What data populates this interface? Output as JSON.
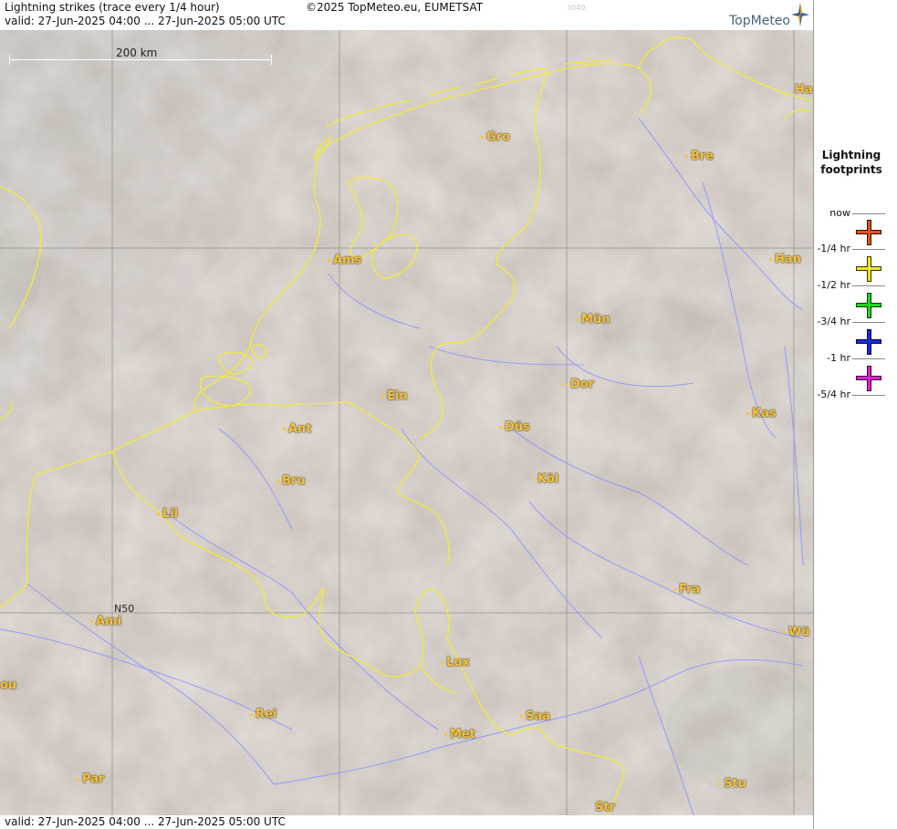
{
  "header": {
    "title": "Lightning strikes (trace every 1/4 hour)",
    "copyright": "©2025 TopMeteo.eu, EUMETSAT",
    "code": "3040",
    "valid": "valid:  27-Jun-2025 04:00 ... 27-Jun-2025 05:00 UTC",
    "brand": "TopMeteo"
  },
  "footer": {
    "valid": "valid:  27-Jun-2025 04:00 ... 27-Jun-2025 05:00 UTC"
  },
  "scale": {
    "label": "200 km"
  },
  "grid": {
    "lat_label": "N50"
  },
  "colors": {
    "border": "#f2ea3a",
    "rivers": "#8c96ff",
    "city": "#f5c542"
  },
  "cities": [
    "Ha",
    "Gro",
    "Bre",
    "Ams",
    "Han",
    "Mün",
    "Dor",
    "Ein",
    "Kas",
    "Ant",
    "Düs",
    "Bru",
    "Köl",
    "Lil",
    "Fra",
    "Ami",
    "Wü",
    "Lux",
    "ou",
    "Rei",
    "Saa",
    "Met",
    "Par",
    "Stu",
    "Str"
  ],
  "legend": {
    "title_line1": "Lightning",
    "title_line2": "footprints",
    "times": [
      "now",
      "-1/4 hr",
      "-1/2 hr",
      "-3/4 hr",
      "-1 hr",
      "-5/4 hr"
    ],
    "crosses": [
      {
        "name": "cross-now-quarter",
        "color": "#e8501a"
      },
      {
        "name": "cross-quarter-half",
        "color": "#f0e81a"
      },
      {
        "name": "cross-half-threequarter",
        "color": "#20d820"
      },
      {
        "name": "cross-threequarter-hour",
        "color": "#1a2ae0"
      },
      {
        "name": "cross-hour-fivequarter",
        "color": "#e020d0"
      }
    ]
  }
}
